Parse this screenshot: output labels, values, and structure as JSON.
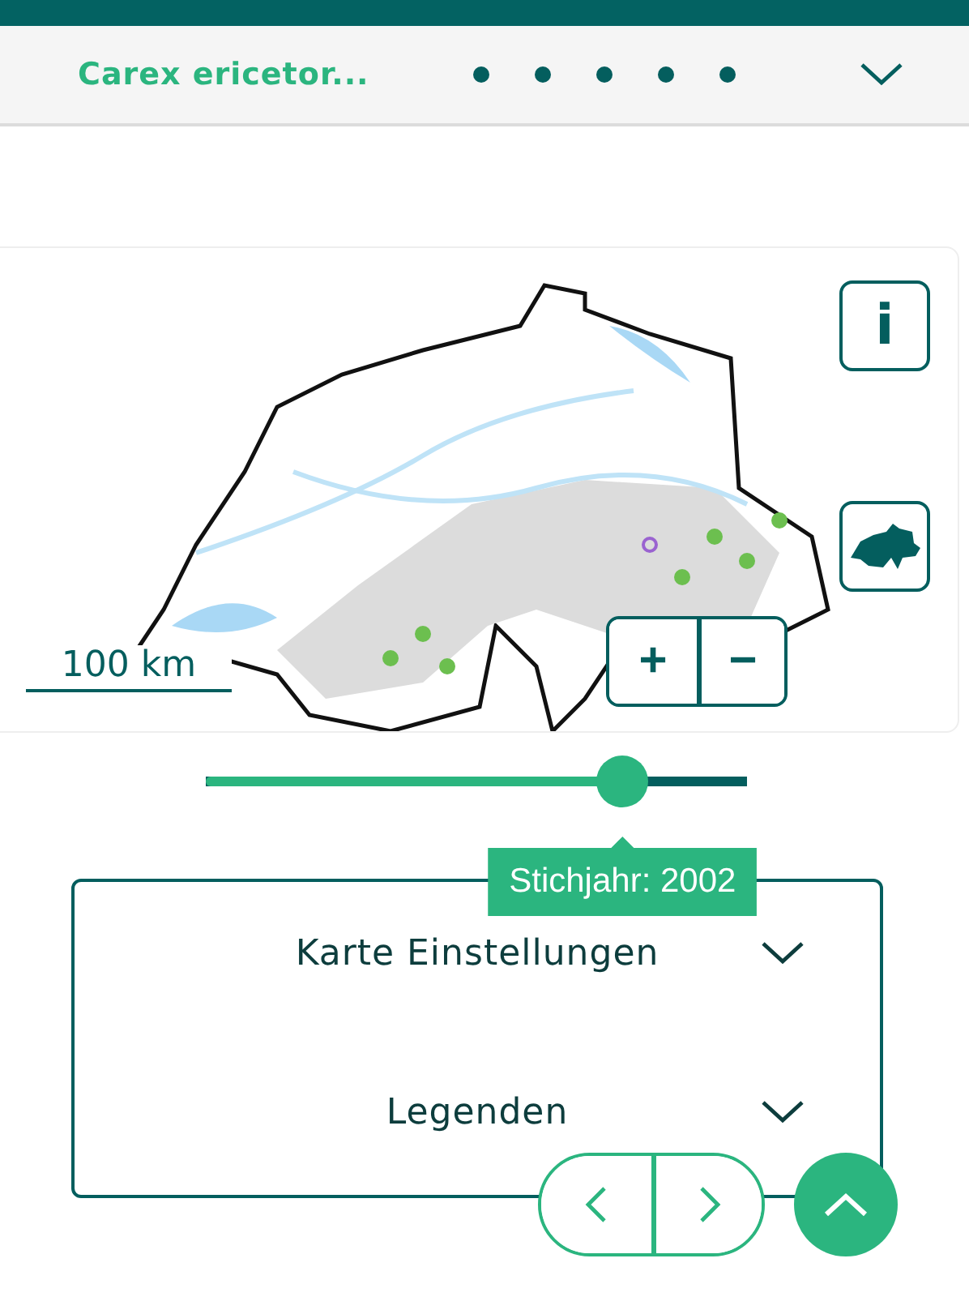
{
  "header": {
    "title": "Carex ericetor...",
    "page_dots": [
      {
        "selected": false
      },
      {
        "selected": false
      },
      {
        "selected": false
      },
      {
        "selected": false
      },
      {
        "selected": false
      }
    ]
  },
  "map": {
    "scale_label": "100 km",
    "info_button": "i",
    "zoom_in": "+",
    "zoom_out": "−"
  },
  "slider": {
    "level": 0.77,
    "tooltip": "Stichjahr: 2002"
  },
  "sections": [
    {
      "label": "Karte Einstellungen",
      "expanded": false
    },
    {
      "label": "Legenden",
      "expanded": false
    }
  ]
}
